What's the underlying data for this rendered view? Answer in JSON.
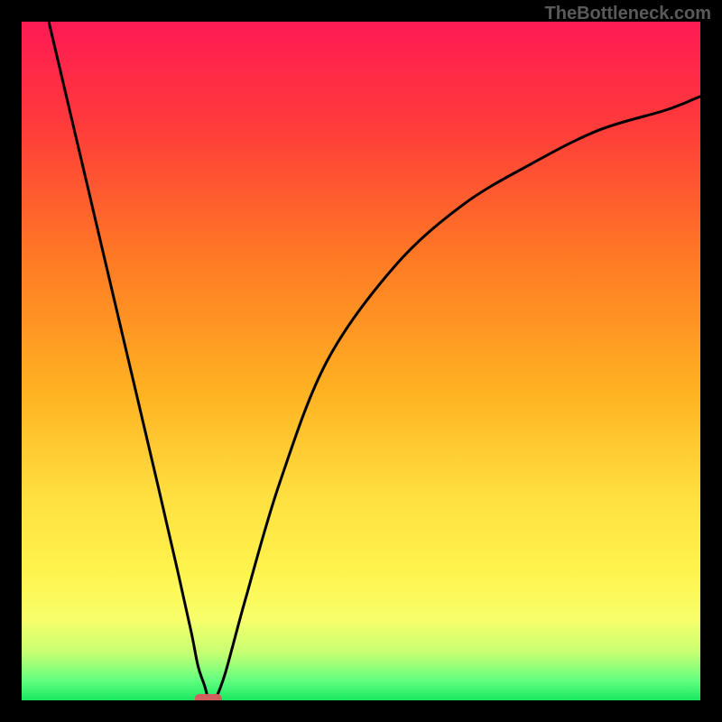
{
  "watermark": "TheBottleneck.com",
  "chart_data": {
    "type": "line",
    "title": "",
    "xlabel": "",
    "ylabel": "",
    "xlim": [
      0,
      100
    ],
    "ylim": [
      0,
      100
    ],
    "series": [
      {
        "name": "left-curve",
        "x": [
          4,
          8,
          12,
          16,
          20,
          23,
          25,
          26,
          27,
          27.5
        ],
        "y": [
          100,
          83,
          66,
          49,
          32,
          19,
          10,
          5,
          2,
          0
        ]
      },
      {
        "name": "right-curve",
        "x": [
          28.5,
          30,
          33,
          38,
          45,
          55,
          65,
          75,
          85,
          95,
          100
        ],
        "y": [
          0,
          4,
          15,
          32,
          50,
          64,
          73,
          79,
          84,
          87,
          89
        ]
      }
    ],
    "marker": {
      "x": 27.5,
      "y": 0,
      "color": "#d0605e"
    },
    "gradient_stops": [
      {
        "offset": 0.0,
        "color": "#ff1a54"
      },
      {
        "offset": 0.15,
        "color": "#ff3a3b"
      },
      {
        "offset": 0.35,
        "color": "#ff7a24"
      },
      {
        "offset": 0.55,
        "color": "#ffb322"
      },
      {
        "offset": 0.7,
        "color": "#ffe040"
      },
      {
        "offset": 0.8,
        "color": "#fff24a"
      },
      {
        "offset": 0.88,
        "color": "#f8ff6a"
      },
      {
        "offset": 0.93,
        "color": "#c6ff72"
      },
      {
        "offset": 0.97,
        "color": "#64ff80"
      },
      {
        "offset": 1.0,
        "color": "#18e860"
      }
    ]
  }
}
